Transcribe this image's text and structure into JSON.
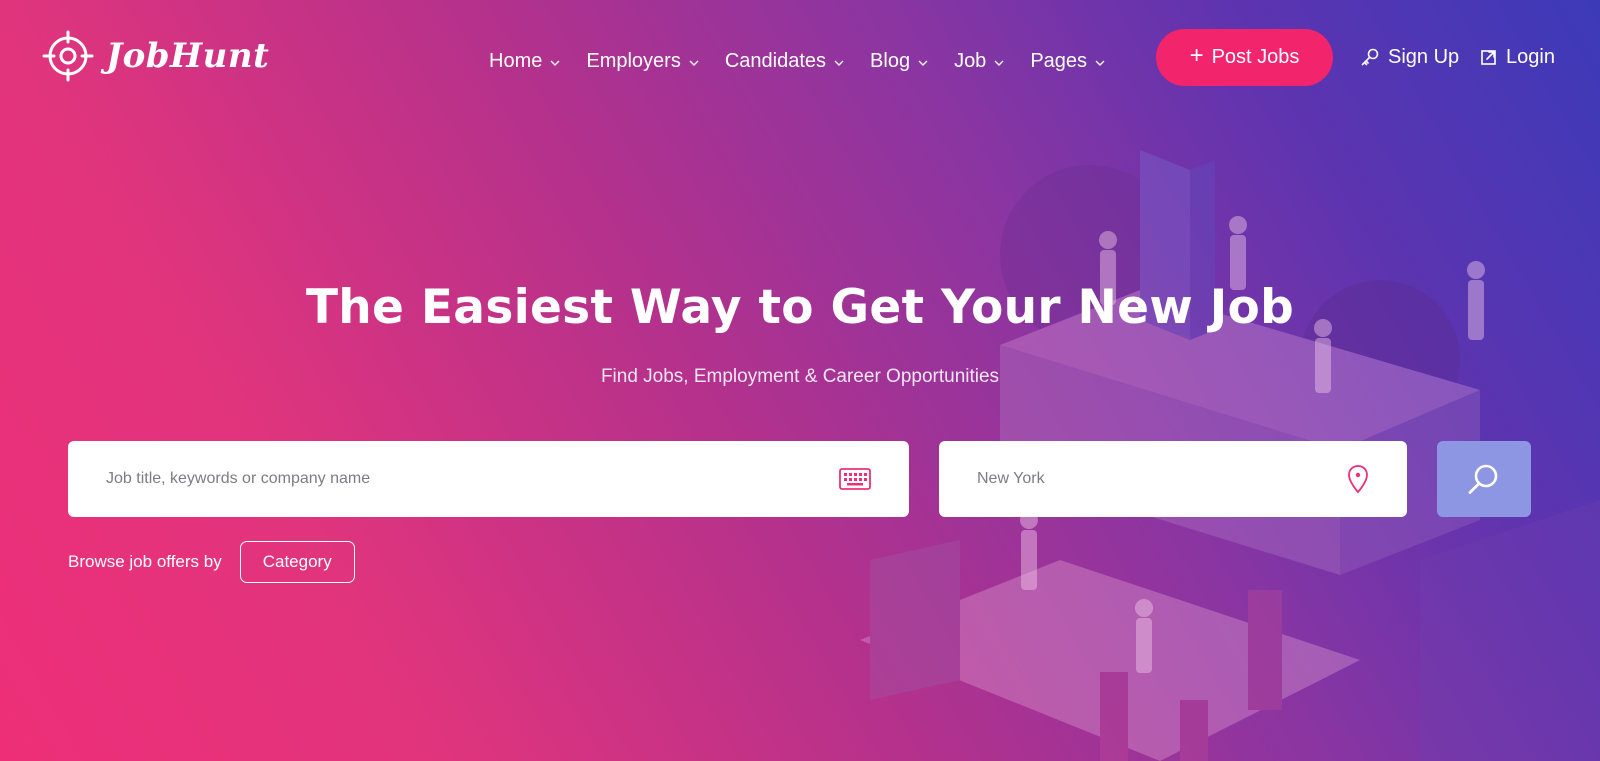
{
  "brand": {
    "name": "JobHunt",
    "logo_icon": "crosshair-icon"
  },
  "nav": [
    {
      "label": "Home"
    },
    {
      "label": "Employers"
    },
    {
      "label": "Candidates"
    },
    {
      "label": "Blog"
    },
    {
      "label": "Job"
    },
    {
      "label": "Pages"
    }
  ],
  "actions": {
    "post_jobs_label": "Post Jobs",
    "sign_up_label": "Sign Up",
    "login_label": "Login"
  },
  "hero": {
    "title": "The Easiest Way to Get Your New Job",
    "subtitle": "Find Jobs, Employment & Career Opportunities"
  },
  "search": {
    "keyword_placeholder": "Job title, keywords or company name",
    "keyword_value": "",
    "location_placeholder": "New York",
    "location_value": "",
    "keyword_icon": "keyboard-icon",
    "location_icon": "map-pin-icon",
    "submit_icon": "search-icon"
  },
  "browse": {
    "label": "Browse job offers by",
    "category_label": "Category"
  },
  "colors": {
    "accent": "#f2246c",
    "search_button": "#8d96e3",
    "gradient_start": "#ee2f78",
    "gradient_end": "#3c3ab8"
  }
}
